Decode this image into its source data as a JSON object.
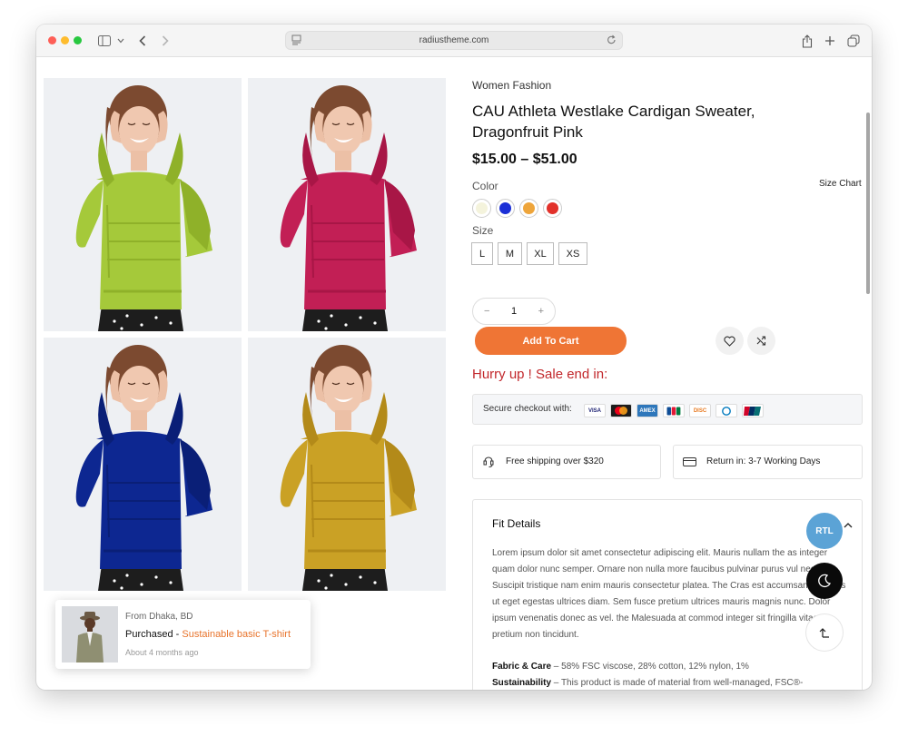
{
  "browser": {
    "url": "radiustheme.com"
  },
  "product": {
    "category": "Women Fashion",
    "title": "CAU Athleta Westlake Cardigan Sweater, Dragonfruit Pink",
    "price": "$15.00 – $51.00",
    "color_label": "Color",
    "size_chart": "Size Chart",
    "colors": [
      "#f4f3dc",
      "#1b2fd6",
      "#eea53b",
      "#e2312a"
    ],
    "size_label": "Size",
    "sizes": [
      "L",
      "M",
      "XL",
      "XS"
    ],
    "qty_minus": "−",
    "qty_value": "1",
    "qty_plus": "+",
    "add_to_cart": "Add To Cart",
    "hurry": "Hurry up ! Sale end in:",
    "secure_checkout": "Secure checkout with:",
    "cards": [
      "VISA",
      "MC",
      "AMEX",
      "JCB",
      "DISC",
      "DC",
      "UP"
    ],
    "shipping": "Free shipping over $320",
    "return": "Return in: 3-7 Working Days"
  },
  "gallery": [
    {
      "color": "#a5c93a",
      "shade": "#8fb129"
    },
    {
      "color": "#c21f55",
      "shade": "#a81646"
    },
    {
      "color": "#0d2791",
      "shade": "#0a1f77"
    },
    {
      "color": "#caa125",
      "shade": "#b38a19"
    }
  ],
  "fit": {
    "heading": "Fit Details",
    "body": "Lorem ipsum dolor sit amet consectetur adipiscing elit. Mauris nullam the as integer quam dolor nunc semper. Ornare non nulla more faucibus pulvinar purus vul neque. Suscipit tristique nam enim mauris consectetur platea. The Cras est accumsan. Egestas ut eget egestas ultrices diam. Sem fusce pretium ultrices mauris magnis nunc. Dolor ipsum venenatis donec as vel. the Malesuada at commod integer sit fringilla vitae in pretium non tincidunt.",
    "fabric_label": "Fabric & Care",
    "fabric_text": " – 58% FSC viscose, 28% cotton, 12% nylon, 1%",
    "sustain_label": "Sustainability",
    "sustain_text": " – This product is made of material from well-managed, FSC®-"
  },
  "floating": {
    "rtl": "RTL"
  },
  "toast": {
    "from": "From Dhaka, BD",
    "purchased": "Purchased - ",
    "product": "Sustainable basic T-shirt",
    "ago": "About 4 months ago"
  }
}
